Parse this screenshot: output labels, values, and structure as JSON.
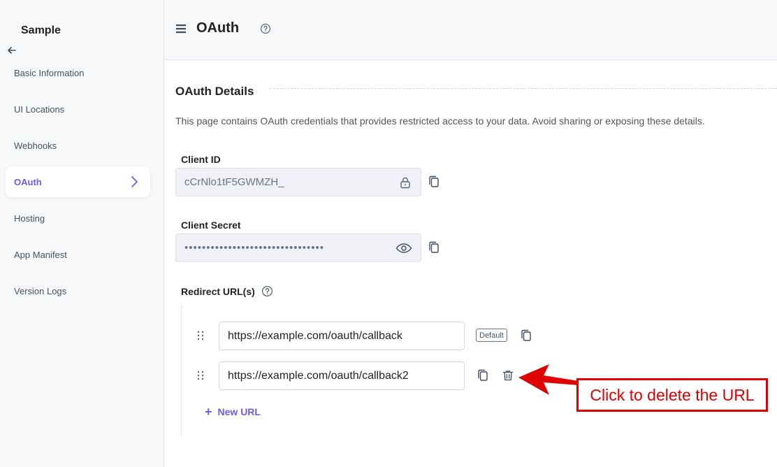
{
  "sidebar": {
    "app_name": "Sample",
    "items": [
      {
        "label": "Basic Information"
      },
      {
        "label": "UI Locations"
      },
      {
        "label": "Webhooks"
      },
      {
        "label": "OAuth"
      },
      {
        "label": "Hosting"
      },
      {
        "label": "App Manifest"
      },
      {
        "label": "Version Logs"
      }
    ],
    "active_index": 3
  },
  "header": {
    "title": "OAuth"
  },
  "main": {
    "section_title": "OAuth Details",
    "description": "This page contains OAuth credentials that provides restricted access to your data. Avoid sharing or exposing these details.",
    "client_id": {
      "label": "Client ID",
      "value": "cCrNlo1tF5GWMZH_"
    },
    "client_secret": {
      "label": "Client Secret",
      "masked_value": "••••••••••••••••••••••••••••••••"
    },
    "redirect": {
      "label": "Redirect URL(s)",
      "urls": [
        {
          "value": "https://example.com/oauth/callback",
          "badge": "Default"
        },
        {
          "value": "https://example.com/oauth/callback2"
        }
      ],
      "new_url_label": "New URL"
    }
  },
  "annotation": {
    "text": "Click to delete the URL",
    "color": "#e00000"
  },
  "colors": {
    "accent": "#6c5ce7",
    "sidebar_bg": "#f7f8fa"
  }
}
